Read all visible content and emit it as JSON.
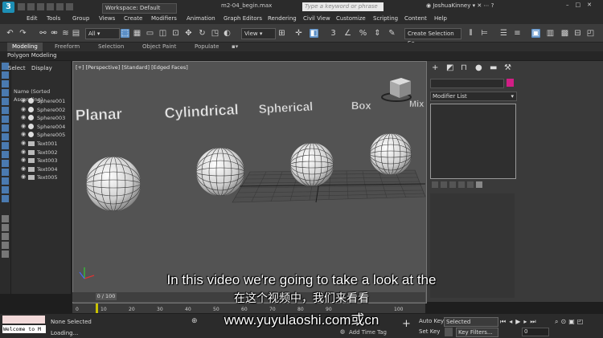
{
  "app": {
    "logo": "3",
    "workspace": "Workspace: Default",
    "file_title": "m2-04_begin.max",
    "search_placeholder": "Type a keyword or phrase",
    "user": "JoshuaKinney"
  },
  "menu": [
    "Edit",
    "Tools",
    "Group",
    "Views",
    "Create",
    "Modifiers",
    "Animation",
    "Graph Editors",
    "Rendering",
    "Civil View",
    "Customize",
    "Scripting",
    "Content",
    "Help"
  ],
  "toolbar": {
    "filter": "All",
    "coord_system": "View",
    "selection_set": "Create Selection Se"
  },
  "ribbon": {
    "tabs": [
      "Modeling",
      "Freeform",
      "Selection",
      "Object Paint",
      "Populate"
    ],
    "active_tab": "Modeling",
    "panel": "Polygon Modeling"
  },
  "scene_explorer": {
    "tabs": [
      "Select",
      "Display"
    ],
    "column_header": "Name (Sorted Ascending)",
    "items": [
      {
        "name": "Sphere001",
        "type": "sphere"
      },
      {
        "name": "Sphere002",
        "type": "sphere"
      },
      {
        "name": "Sphere003",
        "type": "sphere"
      },
      {
        "name": "Sphere004",
        "type": "sphere"
      },
      {
        "name": "Sphere005",
        "type": "sphere"
      },
      {
        "name": "Text001",
        "type": "text"
      },
      {
        "name": "Text002",
        "type": "text"
      },
      {
        "name": "Text003",
        "type": "text"
      },
      {
        "name": "Text004",
        "type": "text"
      },
      {
        "name": "Text005",
        "type": "text"
      }
    ]
  },
  "viewport": {
    "label": "[+] [Perspective] [Standard] [Edged Faces]",
    "text_objects": [
      "Planar",
      "Cylindrical",
      "Spherical",
      "Box",
      "Mix"
    ]
  },
  "command_panel": {
    "modifier_list": "Modifier List",
    "object_color": "#d21e86"
  },
  "timeline": {
    "slider": "0 / 100",
    "ticks": [
      "0",
      "10",
      "20",
      "30",
      "40",
      "50",
      "60",
      "70",
      "80",
      "90",
      "100"
    ]
  },
  "status": {
    "welcome": "Welcome to M",
    "selection": "None Selected",
    "loading": "Loading...",
    "add_time_tag": "Add Time Tag",
    "auto_key": "Auto Key",
    "set_key": "Set Key",
    "key_mode": "Selected",
    "key_filters": "Key Filters...",
    "frame": "0"
  },
  "subtitles": {
    "english": "In this video we're going to take a look at the",
    "chinese": "在这个视频中，我们来看看",
    "url": "www.yuyulaoshi.com或cn"
  }
}
